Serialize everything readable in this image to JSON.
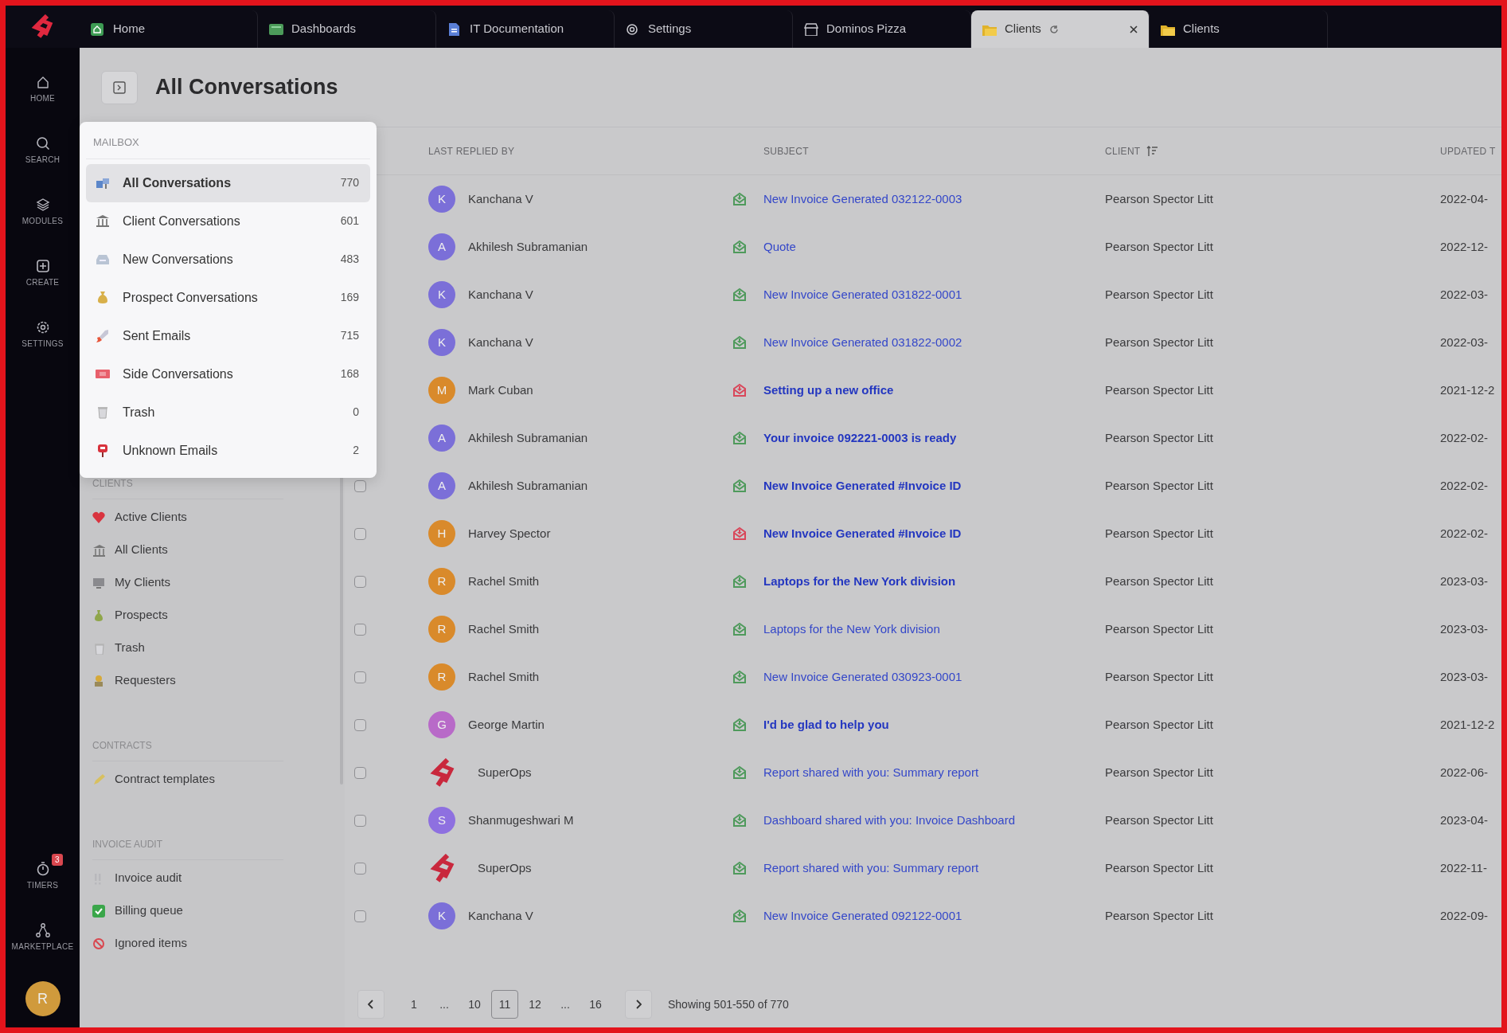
{
  "tabs": [
    {
      "label": "Home",
      "selected": false
    },
    {
      "label": "Dashboards",
      "selected": false
    },
    {
      "label": "IT Documentation",
      "selected": false
    },
    {
      "label": "Settings",
      "selected": false
    },
    {
      "label": "Dominos Pizza",
      "selected": false
    },
    {
      "label": "Clients",
      "selected": true,
      "loading": true,
      "closable": true
    },
    {
      "label": "Clients",
      "selected": false
    }
  ],
  "rail": {
    "items": [
      {
        "label": "HOME"
      },
      {
        "label": "SEARCH"
      },
      {
        "label": "MODULES"
      },
      {
        "label": "CREATE"
      },
      {
        "label": "SETTINGS"
      }
    ],
    "bottom_items": [
      {
        "label": "TIMERS",
        "badge": "3"
      },
      {
        "label": "MARKETPLACE"
      }
    ],
    "user_avatar": "R"
  },
  "page_title": "All Conversations",
  "mailbox_menu": {
    "heading": "MAILBOX",
    "items": [
      {
        "label": "All Conversations",
        "count": "770",
        "selected": true
      },
      {
        "label": "Client Conversations",
        "count": "601",
        "selected": false
      },
      {
        "label": "New Conversations",
        "count": "483",
        "selected": false
      },
      {
        "label": "Prospect Conversations",
        "count": "169",
        "selected": false
      },
      {
        "label": "Sent Emails",
        "count": "715",
        "selected": false
      },
      {
        "label": "Side Conversations",
        "count": "168",
        "selected": false
      },
      {
        "label": "Trash",
        "count": "0",
        "selected": false
      },
      {
        "label": "Unknown Emails",
        "count": "2",
        "selected": false
      }
    ]
  },
  "sidebar": {
    "sections": [
      {
        "heading": "CLIENTS",
        "items": [
          "Active Clients",
          "All Clients",
          "My Clients",
          "Prospects",
          "Trash",
          "Requesters"
        ]
      },
      {
        "heading": "CONTRACTS",
        "items": [
          "Contract templates"
        ]
      },
      {
        "heading": "INVOICE AUDIT",
        "items": [
          "Invoice audit",
          "Billing queue",
          "Ignored items"
        ]
      }
    ]
  },
  "table": {
    "columns": [
      {
        "label": "LAST REPLIED BY",
        "sorted": false
      },
      {
        "label": "SUBJECT",
        "sorted": false
      },
      {
        "label": "CLIENT",
        "sorted": true
      },
      {
        "label": "UPDATED T",
        "sorted": false
      }
    ],
    "rows": [
      {
        "name": "Kanchana V",
        "avatar": {
          "kind": "letter",
          "letter": "K",
          "color": "#7b6fd8"
        },
        "color": "#4f9a5c",
        "subject": "New Invoice Generated 032122-0003",
        "unread": false,
        "client": "Pearson Spector Litt",
        "updated": "2022-04-"
      },
      {
        "name": "Akhilesh Subramanian",
        "avatar": {
          "kind": "letter",
          "letter": "A",
          "color": "#7b6fd8"
        },
        "color": "#4f9a5c",
        "subject": "Quote",
        "unread": false,
        "client": "Pearson Spector Litt",
        "updated": "2022-12-"
      },
      {
        "name": "Kanchana V",
        "avatar": {
          "kind": "letter",
          "letter": "K",
          "color": "#7b6fd8"
        },
        "color": "#4f9a5c",
        "subject": "New Invoice Generated 031822-0001",
        "unread": false,
        "client": "Pearson Spector Litt",
        "updated": "2022-03-"
      },
      {
        "name": "Kanchana V",
        "avatar": {
          "kind": "letter",
          "letter": "K",
          "color": "#7b6fd8"
        },
        "color": "#4f9a5c",
        "subject": "New Invoice Generated 031822-0002",
        "unread": false,
        "client": "Pearson Spector Litt",
        "updated": "2022-03-"
      },
      {
        "name": "Mark Cuban",
        "avatar": {
          "kind": "letter",
          "letter": "M",
          "color": "#d98a2b"
        },
        "color": "#d9475a",
        "subject": "Setting up a new office",
        "unread": true,
        "client": "Pearson Spector Litt",
        "updated": "2021-12-2"
      },
      {
        "name": "Akhilesh Subramanian",
        "avatar": {
          "kind": "letter",
          "letter": "A",
          "color": "#7b6fd8"
        },
        "color": "#4f9a5c",
        "subject": "Your invoice 092221-0003 is ready",
        "unread": true,
        "client": "Pearson Spector Litt",
        "updated": "2022-02-"
      },
      {
        "name": "Akhilesh Subramanian",
        "avatar": {
          "kind": "letter",
          "letter": "A",
          "color": "#7b6fd8"
        },
        "color": "#4f9a5c",
        "subject": "New Invoice Generated #Invoice ID",
        "unread": true,
        "client": "Pearson Spector Litt",
        "updated": "2022-02-",
        "checked": false
      },
      {
        "name": "Harvey Spector",
        "avatar": {
          "kind": "letter",
          "letter": "H",
          "color": "#d98a2b"
        },
        "color": "#d9475a",
        "subject": "New Invoice Generated #Invoice ID",
        "unread": true,
        "client": "Pearson Spector Litt",
        "updated": "2022-02-",
        "checked": false
      },
      {
        "name": "Rachel Smith",
        "avatar": {
          "kind": "letter",
          "letter": "R",
          "color": "#d98a2b"
        },
        "color": "#4f9a5c",
        "subject": "Laptops for the New York division",
        "unread": true,
        "client": "Pearson Spector Litt",
        "updated": "2023-03-",
        "checked": false
      },
      {
        "name": "Rachel Smith",
        "avatar": {
          "kind": "letter",
          "letter": "R",
          "color": "#d98a2b"
        },
        "color": "#4f9a5c",
        "subject": "Laptops for the New York division",
        "unread": false,
        "client": "Pearson Spector Litt",
        "updated": "2023-03-",
        "checked": false
      },
      {
        "name": "Rachel Smith",
        "avatar": {
          "kind": "letter",
          "letter": "R",
          "color": "#d98a2b"
        },
        "color": "#4f9a5c",
        "subject": "New Invoice Generated 030923-0001",
        "unread": false,
        "client": "Pearson Spector Litt",
        "updated": "2023-03-",
        "checked": false
      },
      {
        "name": "George Martin",
        "avatar": {
          "kind": "letter",
          "letter": "G",
          "color": "#b86ac8"
        },
        "color": "#4f9a5c",
        "subject": "I'd be glad to help you",
        "unread": true,
        "client": "Pearson Spector Litt",
        "updated": "2021-12-2",
        "checked": false
      },
      {
        "name": "SuperOps",
        "avatar": {
          "kind": "logo"
        },
        "color": "#4f9a5c",
        "subject": "Report shared with you: Summary report",
        "unread": false,
        "client": "Pearson Spector Litt",
        "updated": "2022-06-",
        "checked": false
      },
      {
        "name": "Shanmugeshwari M",
        "avatar": {
          "kind": "letter",
          "letter": "S",
          "color": "#8e70e0"
        },
        "color": "#4f9a5c",
        "subject": "Dashboard shared with you: Invoice Dashboard",
        "unread": false,
        "client": "Pearson Spector Litt",
        "updated": "2023-04-",
        "checked": false
      },
      {
        "name": "SuperOps",
        "avatar": {
          "kind": "logo"
        },
        "color": "#4f9a5c",
        "subject": "Report shared with you: Summary report",
        "unread": false,
        "client": "Pearson Spector Litt",
        "updated": "2022-11-",
        "checked": false
      },
      {
        "name": "Kanchana V",
        "avatar": {
          "kind": "letter",
          "letter": "K",
          "color": "#7b6fd8"
        },
        "color": "#4f9a5c",
        "subject": "New Invoice Generated 092122-0001",
        "unread": false,
        "client": "Pearson Spector Litt",
        "updated": "2022-09-",
        "checked": false
      }
    ]
  },
  "pagination": {
    "pages": [
      {
        "label": "1",
        "selected": false
      },
      {
        "label": "...",
        "selected": false
      },
      {
        "label": "10",
        "selected": false
      },
      {
        "label": "11",
        "selected": true
      },
      {
        "label": "12",
        "selected": false
      },
      {
        "label": "...",
        "selected": false
      },
      {
        "label": "16",
        "selected": false
      }
    ],
    "summary": "Showing 501-550 of 770"
  }
}
